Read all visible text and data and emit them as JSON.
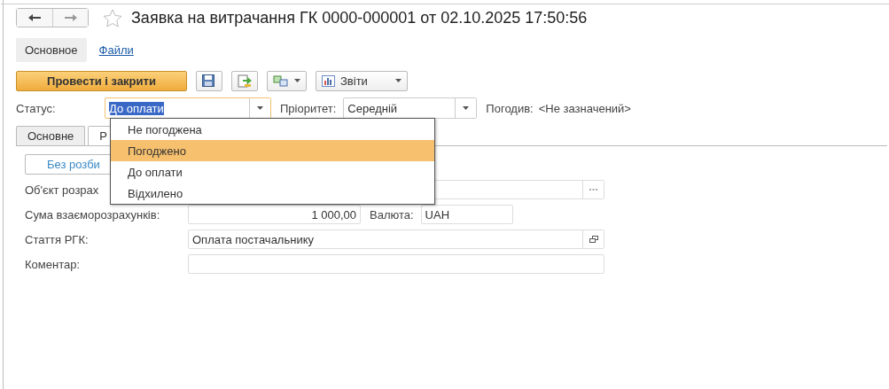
{
  "window": {
    "title": "Заявка на витрачання ГК 0000-000001 от 02.10.2025 17:50:56",
    "favorite": false
  },
  "sections": [
    {
      "label": "Основное",
      "selected": true
    },
    {
      "label": "Файли",
      "selected": false
    }
  ],
  "toolbar": {
    "primary": "Провести і закрити",
    "reports": "Звіти"
  },
  "status": {
    "label": "Статус:",
    "value": "До оплати",
    "priority_label": "Пріоритет:",
    "priority": "Середній",
    "approver_label": "Погодив:",
    "approver": "<Не зазначений>"
  },
  "status_dropdown": [
    {
      "label": "Не погоджена",
      "selected": false
    },
    {
      "label": "Погоджено",
      "selected": true
    },
    {
      "label": "До оплати",
      "selected": false
    },
    {
      "label": "Відхилено",
      "selected": false
    }
  ],
  "tabs": [
    {
      "label": "Основне",
      "selected": false
    },
    {
      "label": "Р",
      "selected": true
    }
  ],
  "split_button": "Без розби",
  "fields": [
    {
      "kind": "choice",
      "label": "Об'єкт розрах"
    },
    {
      "kind": "amount",
      "label": "Сума взаєморозрахунків:",
      "value": "1 000,00",
      "currency_label": "Валюта:",
      "currency": "UAH"
    },
    {
      "kind": "link",
      "label": "Стаття РГК:",
      "value": "Оплата постачальнику"
    },
    {
      "kind": "text",
      "label": "Коментар:"
    }
  ]
}
